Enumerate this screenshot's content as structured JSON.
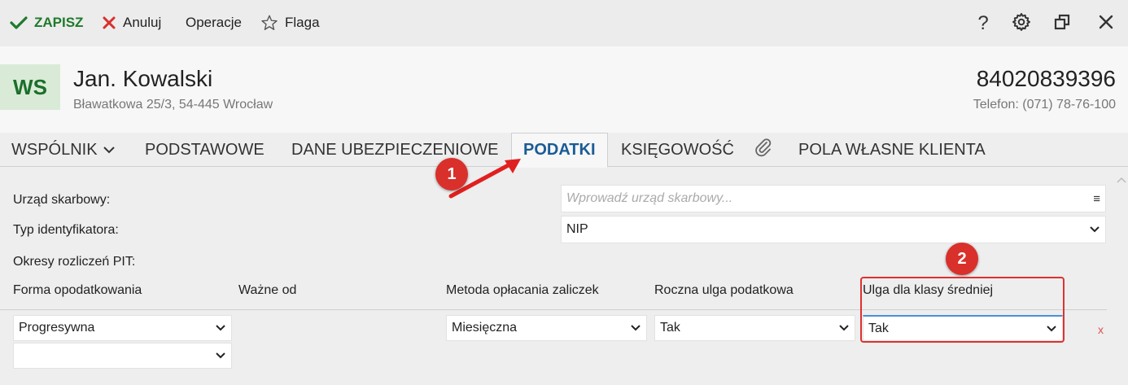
{
  "toolbar": {
    "save_label": "ZAPISZ",
    "cancel_label": "Anuluj",
    "operations_label": "Operacje",
    "flag_label": "Flaga",
    "help_label": "?"
  },
  "client": {
    "initials": "WS",
    "name": "Jan. Kowalski",
    "address": "Bławatkowa 25/3, 54-445 Wrocław",
    "id_number": "84020839396",
    "phone": "Telefon: (071) 78-76-100"
  },
  "tabs": [
    {
      "label": "WSPÓLNIK"
    },
    {
      "label": "PODSTAWOWE"
    },
    {
      "label": "DANE UBEZPIECZENIOWE"
    },
    {
      "label": "PODATKI"
    },
    {
      "label": "KSIĘGOWOŚĆ"
    },
    {
      "label": "POLA WŁASNE KLIENTA"
    }
  ],
  "form": {
    "tax_office_label": "Urząd skarbowy:",
    "tax_office_placeholder": "Wprowadź urząd skarbowy...",
    "tax_office_menu": "≡",
    "id_type_label": "Typ identyfikatora:",
    "id_type_value": "NIP",
    "pit_periods_label": "Okresy rozliczeń PIT:",
    "columns": [
      "Forma opodatkowania",
      "Ważne od",
      "Metoda opłacania zaliczek",
      "Roczna ulga podatkowa",
      "Ulga dla klasy średniej"
    ],
    "row": {
      "forma": "Progresywna",
      "metoda": "Miesięczna",
      "roczna_ulga": "Tak",
      "ulga_klasy": "Tak",
      "remove": "x"
    },
    "empty_select": ""
  },
  "annotations": {
    "step1": "1",
    "step2": "2",
    "color": "#d9302b"
  },
  "colors": {
    "accent_green": "#1f7a2b",
    "active_tab": "#1a5c96",
    "cancel_red": "#d9302b"
  },
  "icons": [
    "check-icon",
    "close-icon",
    "star-icon",
    "help-icon",
    "gear-icon",
    "restore-window-icon",
    "window-close-icon",
    "chevron-down-icon",
    "paperclip-icon",
    "menu-icon"
  ]
}
